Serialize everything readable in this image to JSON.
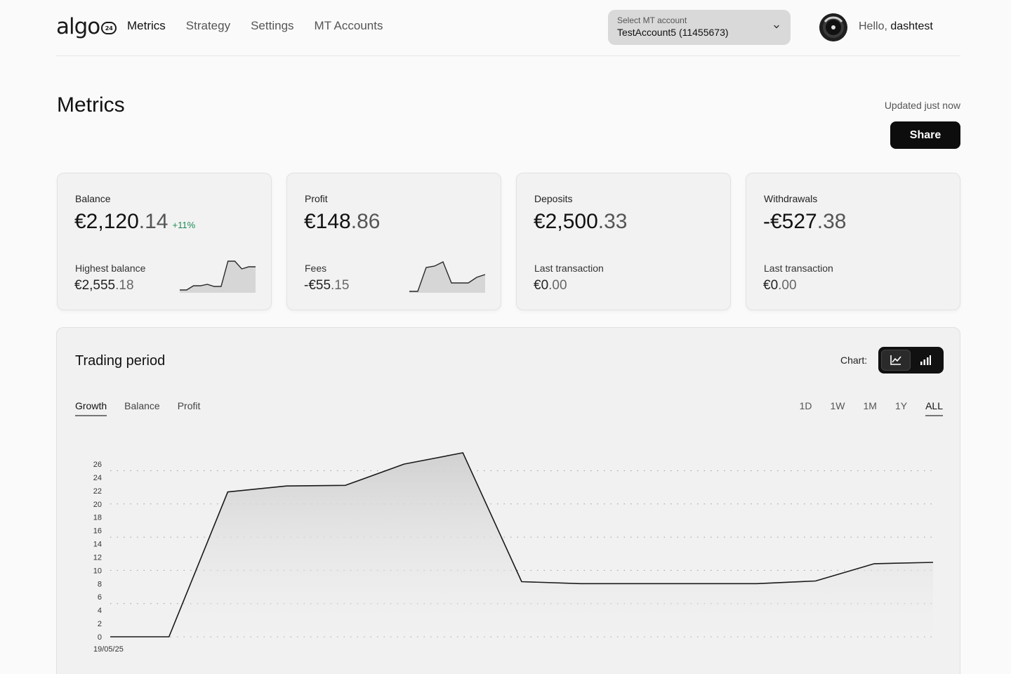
{
  "header": {
    "logo_text": "algo",
    "logo_badge": "24",
    "nav": [
      {
        "label": "Metrics",
        "active": true
      },
      {
        "label": "Strategy",
        "active": false
      },
      {
        "label": "Settings",
        "active": false
      },
      {
        "label": "MT Accounts",
        "active": false
      }
    ],
    "account_select": {
      "label": "Select MT account",
      "value": "TestAccount5 (11455673)"
    },
    "greeting": "Hello,",
    "username": "dashtest"
  },
  "page": {
    "title": "Metrics",
    "updated": "Updated just now",
    "share_label": "Share"
  },
  "cards": [
    {
      "label": "Balance",
      "value_main": "€2,120",
      "value_dec": ".14",
      "change": "+11%",
      "sub_label": "Highest balance",
      "sub_main": "€2,555",
      "sub_dec": ".18",
      "sparkline": [
        2,
        2,
        8,
        8,
        10,
        7,
        7,
        43,
        43,
        32,
        35,
        35
      ]
    },
    {
      "label": "Profit",
      "value_main": "€148",
      "value_dec": ".86",
      "change": "",
      "sub_label": "Fees",
      "sub_main": "-€55",
      "sub_dec": ".15",
      "sparkline": [
        0,
        0,
        34,
        36,
        42,
        12,
        12,
        12,
        20,
        24
      ]
    },
    {
      "label": "Deposits",
      "value_main": "€2,500",
      "value_dec": ".33",
      "change": "",
      "sub_label": "Last transaction",
      "sub_main": "€0",
      "sub_dec": ".00"
    },
    {
      "label": "Withdrawals",
      "value_main": "-€527",
      "value_dec": ".38",
      "change": "",
      "sub_label": "Last transaction",
      "sub_main": "€0",
      "sub_dec": ".00"
    }
  ],
  "trading": {
    "title": "Trading period",
    "chart_label": "Chart:",
    "chart_modes": [
      {
        "icon": "line-chart-icon",
        "active": true
      },
      {
        "icon": "bar-chart-icon",
        "active": false
      }
    ],
    "tabs": [
      {
        "label": "Growth",
        "active": true
      },
      {
        "label": "Balance",
        "active": false
      },
      {
        "label": "Profit",
        "active": false
      }
    ],
    "ranges": [
      {
        "label": "1D",
        "active": false
      },
      {
        "label": "1W",
        "active": false
      },
      {
        "label": "1M",
        "active": false
      },
      {
        "label": "1Y",
        "active": false
      },
      {
        "label": "ALL",
        "active": true
      }
    ]
  },
  "chart_data": {
    "type": "area",
    "title": "",
    "xlabel": "",
    "ylabel": "",
    "x_tick_labels": [
      "19/05/25"
    ],
    "y_ticks": [
      0,
      2,
      4,
      6,
      8,
      10,
      12,
      14,
      16,
      18,
      20,
      22,
      24,
      26
    ],
    "ylim": [
      0,
      26
    ],
    "grid": true,
    "series": [
      {
        "values": [
          0,
          0,
          21.8,
          22.7,
          22.8,
          26.0,
          27.7,
          8.3,
          8.0,
          8.0,
          8.0,
          8.0,
          8.4,
          11.0,
          11.2
        ]
      }
    ]
  }
}
